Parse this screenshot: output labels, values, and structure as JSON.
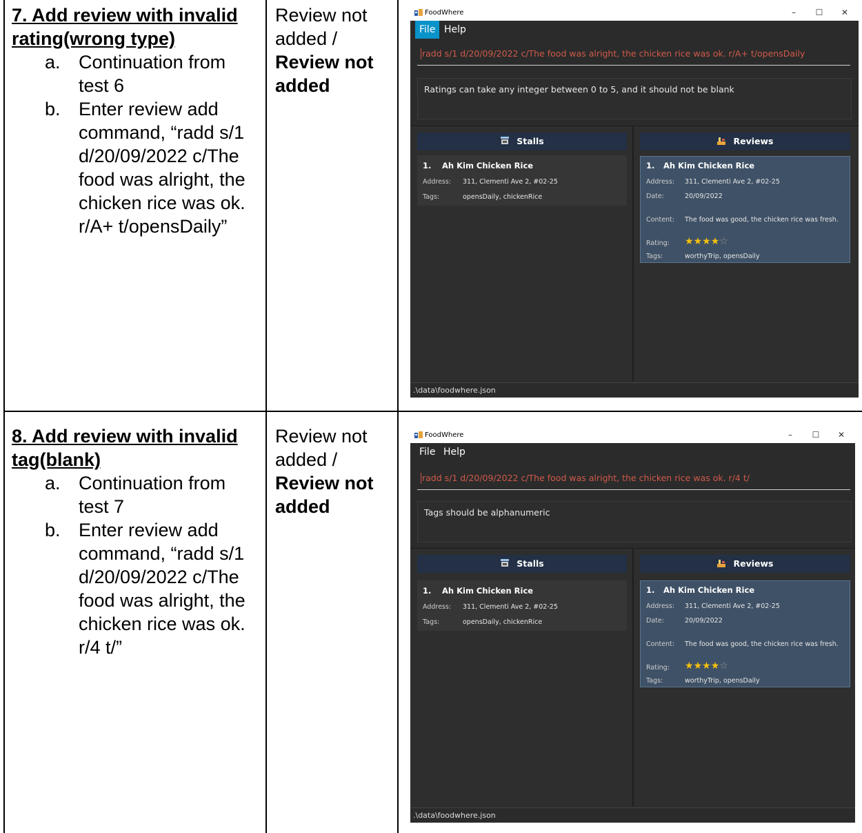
{
  "rows": [
    {
      "title": "7. Add review with invalid rating(wrong type)",
      "steps": [
        {
          "marker": "a.",
          "text": "Continuation from test 6"
        },
        {
          "marker": "b.",
          "text": "Enter review add command, “radd s/1 d/20/09/2022 c/The food was alright, the chicken rice was ok. r/A+ t/opensDaily”"
        }
      ],
      "expected": "Review not added /",
      "actual": "Review not added",
      "app": {
        "window_title": "FoodWhere",
        "menu": [
          "File",
          "Help"
        ],
        "command": "radd s/1 d/20/09/2022 c/The food was alright, the chicken rice was ok. r/A+ t/opensDaily",
        "result": "Ratings can take any integer between 0 to 5, and it should not be blank",
        "stalls_header": "Stalls",
        "reviews_header": "Reviews",
        "stall": {
          "index": "1.",
          "name": "Ah Kim Chicken Rice",
          "address_label": "Address:",
          "address": "311, Clementi Ave 2, #02-25",
          "tags_label": "Tags:",
          "tags": "opensDaily, chickenRice"
        },
        "review": {
          "index": "1.",
          "name": "Ah Kim Chicken Rice",
          "address_label": "Address:",
          "address": "311, Clementi Ave 2, #02-25",
          "date_label": "Date:",
          "date": "20/09/2022",
          "content_label": "Content:",
          "content": "The food was good, the chicken rice was fresh.",
          "rating_label": "Rating:",
          "rating": 4,
          "rating_max": 5,
          "tags_label": "Tags:",
          "tags": "worthyTrip, opensDaily"
        },
        "status": ".\\data\\foodwhere.json"
      }
    },
    {
      "title": "8. Add review with invalid tag(blank)",
      "steps": [
        {
          "marker": "a.",
          "text": "Continuation from test 7"
        },
        {
          "marker": "b.",
          "text": "Enter review add command, “radd s/1 d/20/09/2022 c/The food was alright, the chicken rice was ok. r/4 t/”"
        }
      ],
      "expected": "Review not added /",
      "actual": "Review not added",
      "app": {
        "window_title": "FoodWhere",
        "menu": [
          "File",
          "Help"
        ],
        "command": "radd s/1 d/20/09/2022 c/The food was alright, the chicken rice was ok. r/4 t/",
        "result": "Tags should be alphanumeric",
        "stalls_header": "Stalls",
        "reviews_header": "Reviews",
        "stall": {
          "index": "1.",
          "name": "Ah Kim Chicken Rice",
          "address_label": "Address:",
          "address": "311, Clementi Ave 2, #02-25",
          "tags_label": "Tags:",
          "tags": "opensDaily, chickenRice"
        },
        "review": {
          "index": "1.",
          "name": "Ah Kim Chicken Rice",
          "address_label": "Address:",
          "address": "311, Clementi Ave 2, #02-25",
          "date_label": "Date:",
          "date": "20/09/2022",
          "content_label": "Content:",
          "content": "The food was good, the chicken rice was fresh.",
          "rating_label": "Rating:",
          "rating": 4,
          "rating_max": 5,
          "tags_label": "Tags:",
          "tags": "worthyTrip, opensDaily"
        },
        "status": ".\\data\\foodwhere.json"
      }
    }
  ],
  "colors": {
    "accent": "#0a93c9",
    "panel_header": "#233046",
    "selected_card": "#3f5166",
    "command_text": "#d05a4a",
    "star": "#f4c20d"
  }
}
